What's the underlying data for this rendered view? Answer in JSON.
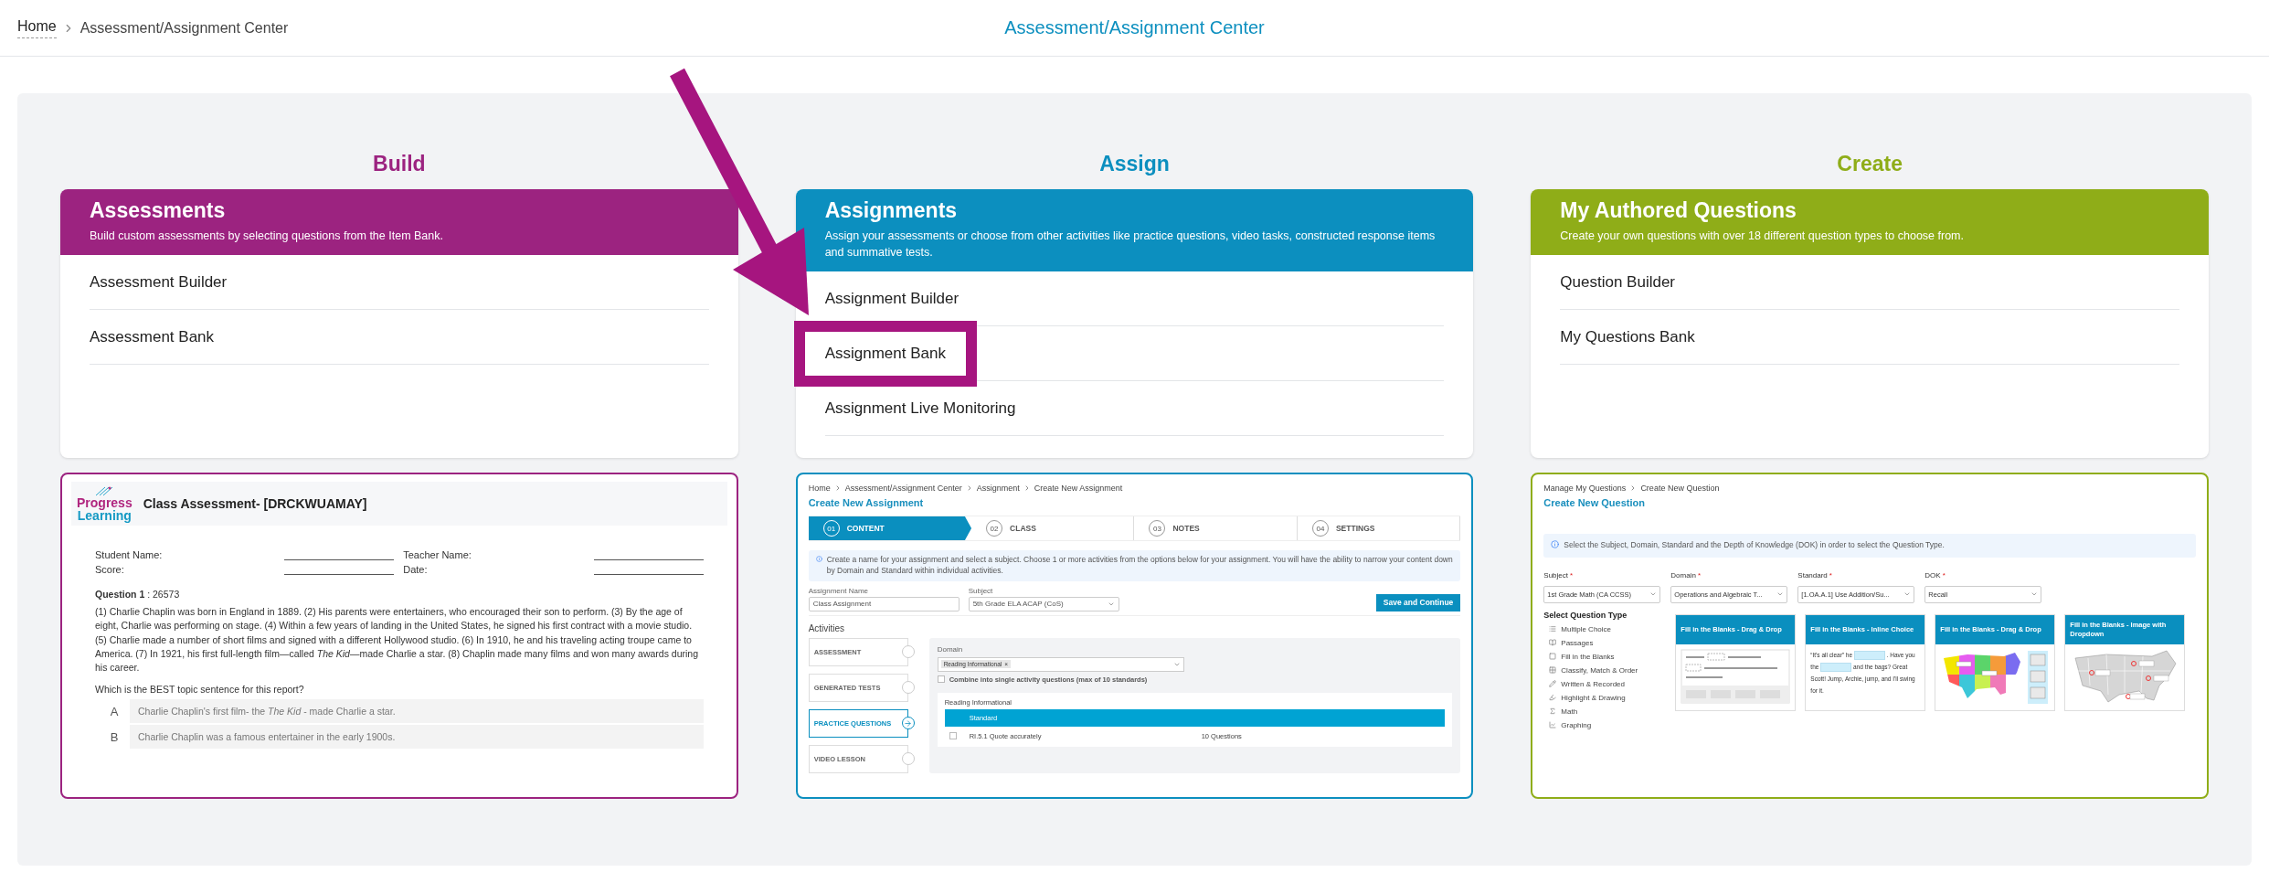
{
  "breadcrumb": [
    {
      "label": "Home"
    },
    {
      "label": "Assessment/Assignment Center"
    }
  ],
  "page_title": "Assessment/Assignment Center",
  "columns": [
    {
      "heading": "Build",
      "color": "#9c2380",
      "card": {
        "title": "Assessments",
        "subtitle": "Build custom assessments by selecting questions from the Item Bank.",
        "items": [
          {
            "label": "Assessment Builder",
            "highlighted": false
          },
          {
            "label": "Assessment Bank",
            "highlighted": false
          }
        ]
      },
      "preview": {
        "kind": "assessment",
        "logo": [
          "Progress",
          "Learning"
        ],
        "title": "Class Assessment- [DRCKWUAMAY]",
        "fields": [
          {
            "label": "Student Name:"
          },
          {
            "label": "Teacher Name:"
          },
          {
            "label": "Score:"
          },
          {
            "label": "Date:"
          }
        ],
        "question": "**Question 1** : 26573",
        "passage": "(1) Charlie Chaplin was born in England in 1889. (2) His parents were entertainers, who encouraged their son to perform. (3) By the age of eight, Charlie was performing on stage. (4) Within a few years of landing in the United States, he signed his first contract with a movie studio. (5) Charlie made a number of short films and signed with a different Hollywood studio. (6) In 1910, he and his traveling acting troupe came to America. (7) In 1921, his first full-length film—called *The Kid*—made Charlie a star. (8) Chaplin made many films and won many awards during his career.",
        "prompt": "Which is the BEST topic sentence for this report?",
        "choices": [
          {
            "letter": "A",
            "text": "Charlie Chaplin's first film- the *The Kid* - made Charlie a star."
          },
          {
            "letter": "B",
            "text": "Charlie Chaplin was a famous entertainer in the early 1900s."
          }
        ]
      }
    },
    {
      "heading": "Assign",
      "color": "#0c8fbf",
      "card": {
        "title": "Assignments",
        "subtitle": "Assign your assessments or choose from other activities like practice questions, video tasks, constructed response items and summative tests.",
        "items": [
          {
            "label": "Assignment Builder",
            "highlighted": false
          },
          {
            "label": "Assignment Bank",
            "highlighted": true
          },
          {
            "label": "Assignment Live Monitoring",
            "highlighted": false
          }
        ]
      },
      "preview": {
        "kind": "assignment",
        "breadcrumb": [
          "Home",
          "Assessment/Assignment Center",
          "Assignment",
          "Create New Assignment"
        ],
        "title": "Create New Assignment",
        "steps": [
          {
            "number": "01",
            "label": "CONTENT",
            "selected": true
          },
          {
            "number": "02",
            "label": "CLASS",
            "selected": false
          },
          {
            "number": "03",
            "label": "NOTES",
            "selected": false
          },
          {
            "number": "04",
            "label": "SETTINGS",
            "selected": false
          }
        ],
        "info": "Create a name for your assignment and select a subject. Choose 1 or more activities from the options below for your assignment. You will have the ability to narrow your content down by Domain and Standard within individual activities.",
        "fields": [
          {
            "label": "Assignment Name",
            "value": "Class Assignment"
          },
          {
            "label": "Subject",
            "value": "5th Grade ELA ACAP (CoS)"
          }
        ],
        "save_button": "Save and Continue",
        "activities_title": "Activities",
        "activities": [
          {
            "label": "ASSESSMENT",
            "selected": false
          },
          {
            "label": "GENERATED TESTS",
            "selected": false
          },
          {
            "label": "PRACTICE QUESTIONS",
            "selected": true
          },
          {
            "label": "VIDEO LESSON",
            "selected": false
          }
        ],
        "domain_label": "Domain",
        "domain_tag": "Reading Informational",
        "tag_remove": "×",
        "combine": {
          "label": "Combine into single activity questions (max of 10 standards)",
          "checked": false
        },
        "table_caption": "Reading Informational",
        "table_header": "Standard",
        "rows": [
          {
            "standard": "RI.5.1 Quote accurately",
            "count": "10 Questions",
            "checked": false
          }
        ]
      }
    },
    {
      "heading": "Create",
      "color": "#8fad18",
      "card": {
        "title": "My Authored Questions",
        "subtitle": "Create your own questions with over 18 different question types to choose from.",
        "items": [
          {
            "label": "Question Builder",
            "highlighted": false
          },
          {
            "label": "My Questions Bank",
            "highlighted": false
          }
        ]
      },
      "preview": {
        "kind": "question",
        "breadcrumb": [
          "Manage My Questions",
          "Create New Question"
        ],
        "title": "Create New Question",
        "info": "Select the Subject, Domain, Standard and the Depth of Knowledge (DOK) in order to select the Question Type.",
        "selects": [
          {
            "label": "Subject",
            "required": "*",
            "value": "1st Grade Math (CA CCSS)"
          },
          {
            "label": "Domain",
            "required": "*",
            "value": "Operations and Algebraic T..."
          },
          {
            "label": "Standard",
            "required": "*",
            "value": "[1.OA.A.1] Use Addition/Su..."
          },
          {
            "label": "DOK",
            "required": "*",
            "value": "Recall"
          }
        ],
        "types_title": "Select Question Type",
        "types": [
          {
            "label": "Multiple Choice"
          },
          {
            "label": "Passages"
          },
          {
            "label": "Fill in the Blanks"
          },
          {
            "label": "Classify, Match & Order"
          },
          {
            "label": "Written & Recorded"
          },
          {
            "label": "Highlight & Drawing"
          },
          {
            "label": "Math"
          },
          {
            "label": "Graphing"
          }
        ],
        "cards": [
          {
            "title": "Fill in the Blanks - Drag & Drop",
            "kind": "worksheet"
          },
          {
            "title": "Fill in the Blanks - Inline Choice",
            "kind": "inline",
            "segments": [
              "“It's all clear” he",
              ". Have you the",
              "and the bags? Great Scott! Jump, Archie, jump, and I'll swing for it."
            ]
          },
          {
            "title": "Fill in the Blanks - Drag & Drop",
            "kind": "color-map"
          },
          {
            "title": "Fill in the Blanks - Image with Dropdown",
            "kind": "grey-map"
          }
        ]
      }
    }
  ]
}
